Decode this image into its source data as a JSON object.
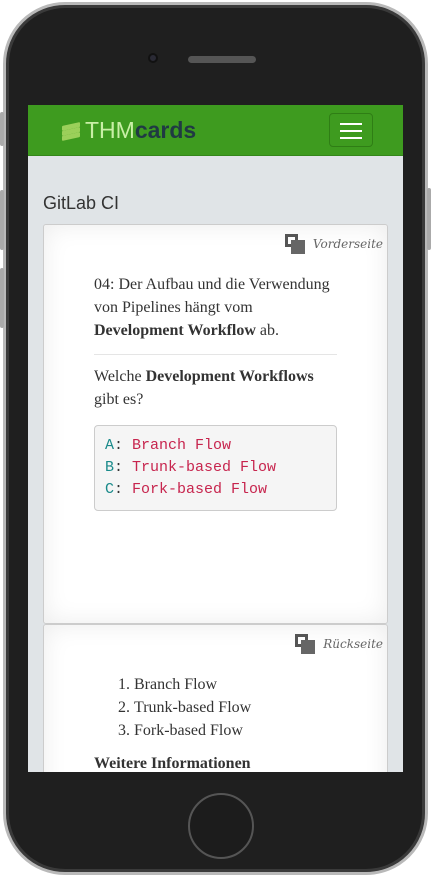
{
  "navbar": {
    "logo_prefix": "THM",
    "logo_suffix": "cards",
    "menu_icon": "hamburger-icon",
    "brand_color": "#3e9b1f"
  },
  "page": {
    "title": "GitLab CI"
  },
  "front": {
    "side_label": "Vorderseite",
    "intro_pre": "04: Der Aufbau und die Verwendung von Pipelines hängt vom ",
    "intro_bold": "Development Workflow",
    "intro_post": " ab.",
    "question_pre": "Welche ",
    "question_bold": "Development Workflows",
    "question_post": " gibt es?",
    "options": [
      {
        "key": "A",
        "value": "Branch Flow"
      },
      {
        "key": "B",
        "value": "Trunk-based Flow"
      },
      {
        "key": "C",
        "value": "Fork-based Flow"
      }
    ]
  },
  "back": {
    "side_label": "Rückseite",
    "answers": [
      "Branch Flow",
      "Trunk-based Flow",
      "Fork-based Flow"
    ],
    "more_heading": "Weitere Informationen"
  }
}
